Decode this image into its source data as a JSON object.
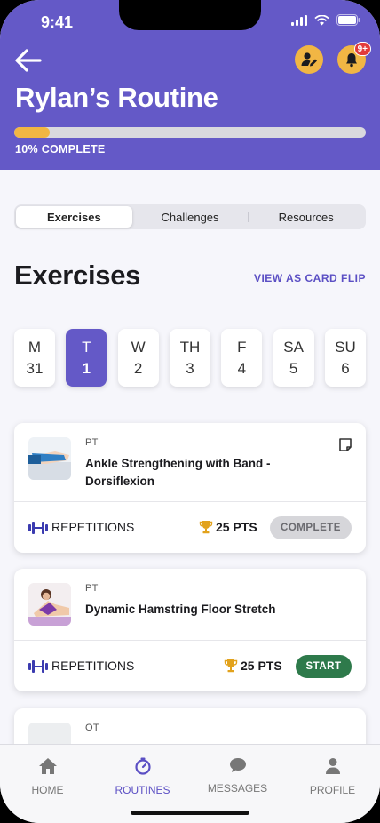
{
  "status_bar": {
    "time": "9:41"
  },
  "header": {
    "title": "Rylan’s Routine",
    "progress_fraction": 0.1,
    "progress_label": "10% COMPLETE",
    "notification_badge": "9+",
    "accent_color": "#6459c7",
    "badge_color": "#e23b3b",
    "icons": {
      "back": "arrow-left-icon",
      "edit_user": "user-edit-icon",
      "notifications": "bell-icon"
    }
  },
  "segments": [
    {
      "label": "Exercises",
      "active": true
    },
    {
      "label": "Challenges",
      "active": false
    },
    {
      "label": "Resources",
      "active": false
    }
  ],
  "section": {
    "title": "Exercises",
    "card_flip_link": "VIEW AS CARD FLIP"
  },
  "days": [
    {
      "name": "M",
      "num": "31",
      "active": false
    },
    {
      "name": "T",
      "num": "1",
      "active": true
    },
    {
      "name": "W",
      "num": "2",
      "active": false
    },
    {
      "name": "TH",
      "num": "3",
      "active": false
    },
    {
      "name": "F",
      "num": "4",
      "active": false
    },
    {
      "name": "SA",
      "num": "5",
      "active": false
    },
    {
      "name": "SU",
      "num": "6",
      "active": false
    }
  ],
  "exercises": [
    {
      "type": "PT",
      "name": "Ankle Strengthening with Band - Dorsiflexion",
      "metric": "REPETITIONS",
      "points": "25 PTS",
      "action": "COMPLETE",
      "status": "complete"
    },
    {
      "type": "PT",
      "name": "Dynamic Hamstring Floor Stretch",
      "metric": "REPETITIONS",
      "points": "25 PTS",
      "action": "START",
      "status": "start"
    },
    {
      "type": "OT",
      "name": ""
    }
  ],
  "tabbar": [
    {
      "label": "HOME",
      "icon": "home-icon",
      "active": false
    },
    {
      "label": "ROUTINES",
      "icon": "timer-icon",
      "active": true
    },
    {
      "label": "MESSAGES",
      "icon": "chat-bubble-icon",
      "active": false
    },
    {
      "label": "PROFILE",
      "icon": "person-icon",
      "active": false
    }
  ]
}
